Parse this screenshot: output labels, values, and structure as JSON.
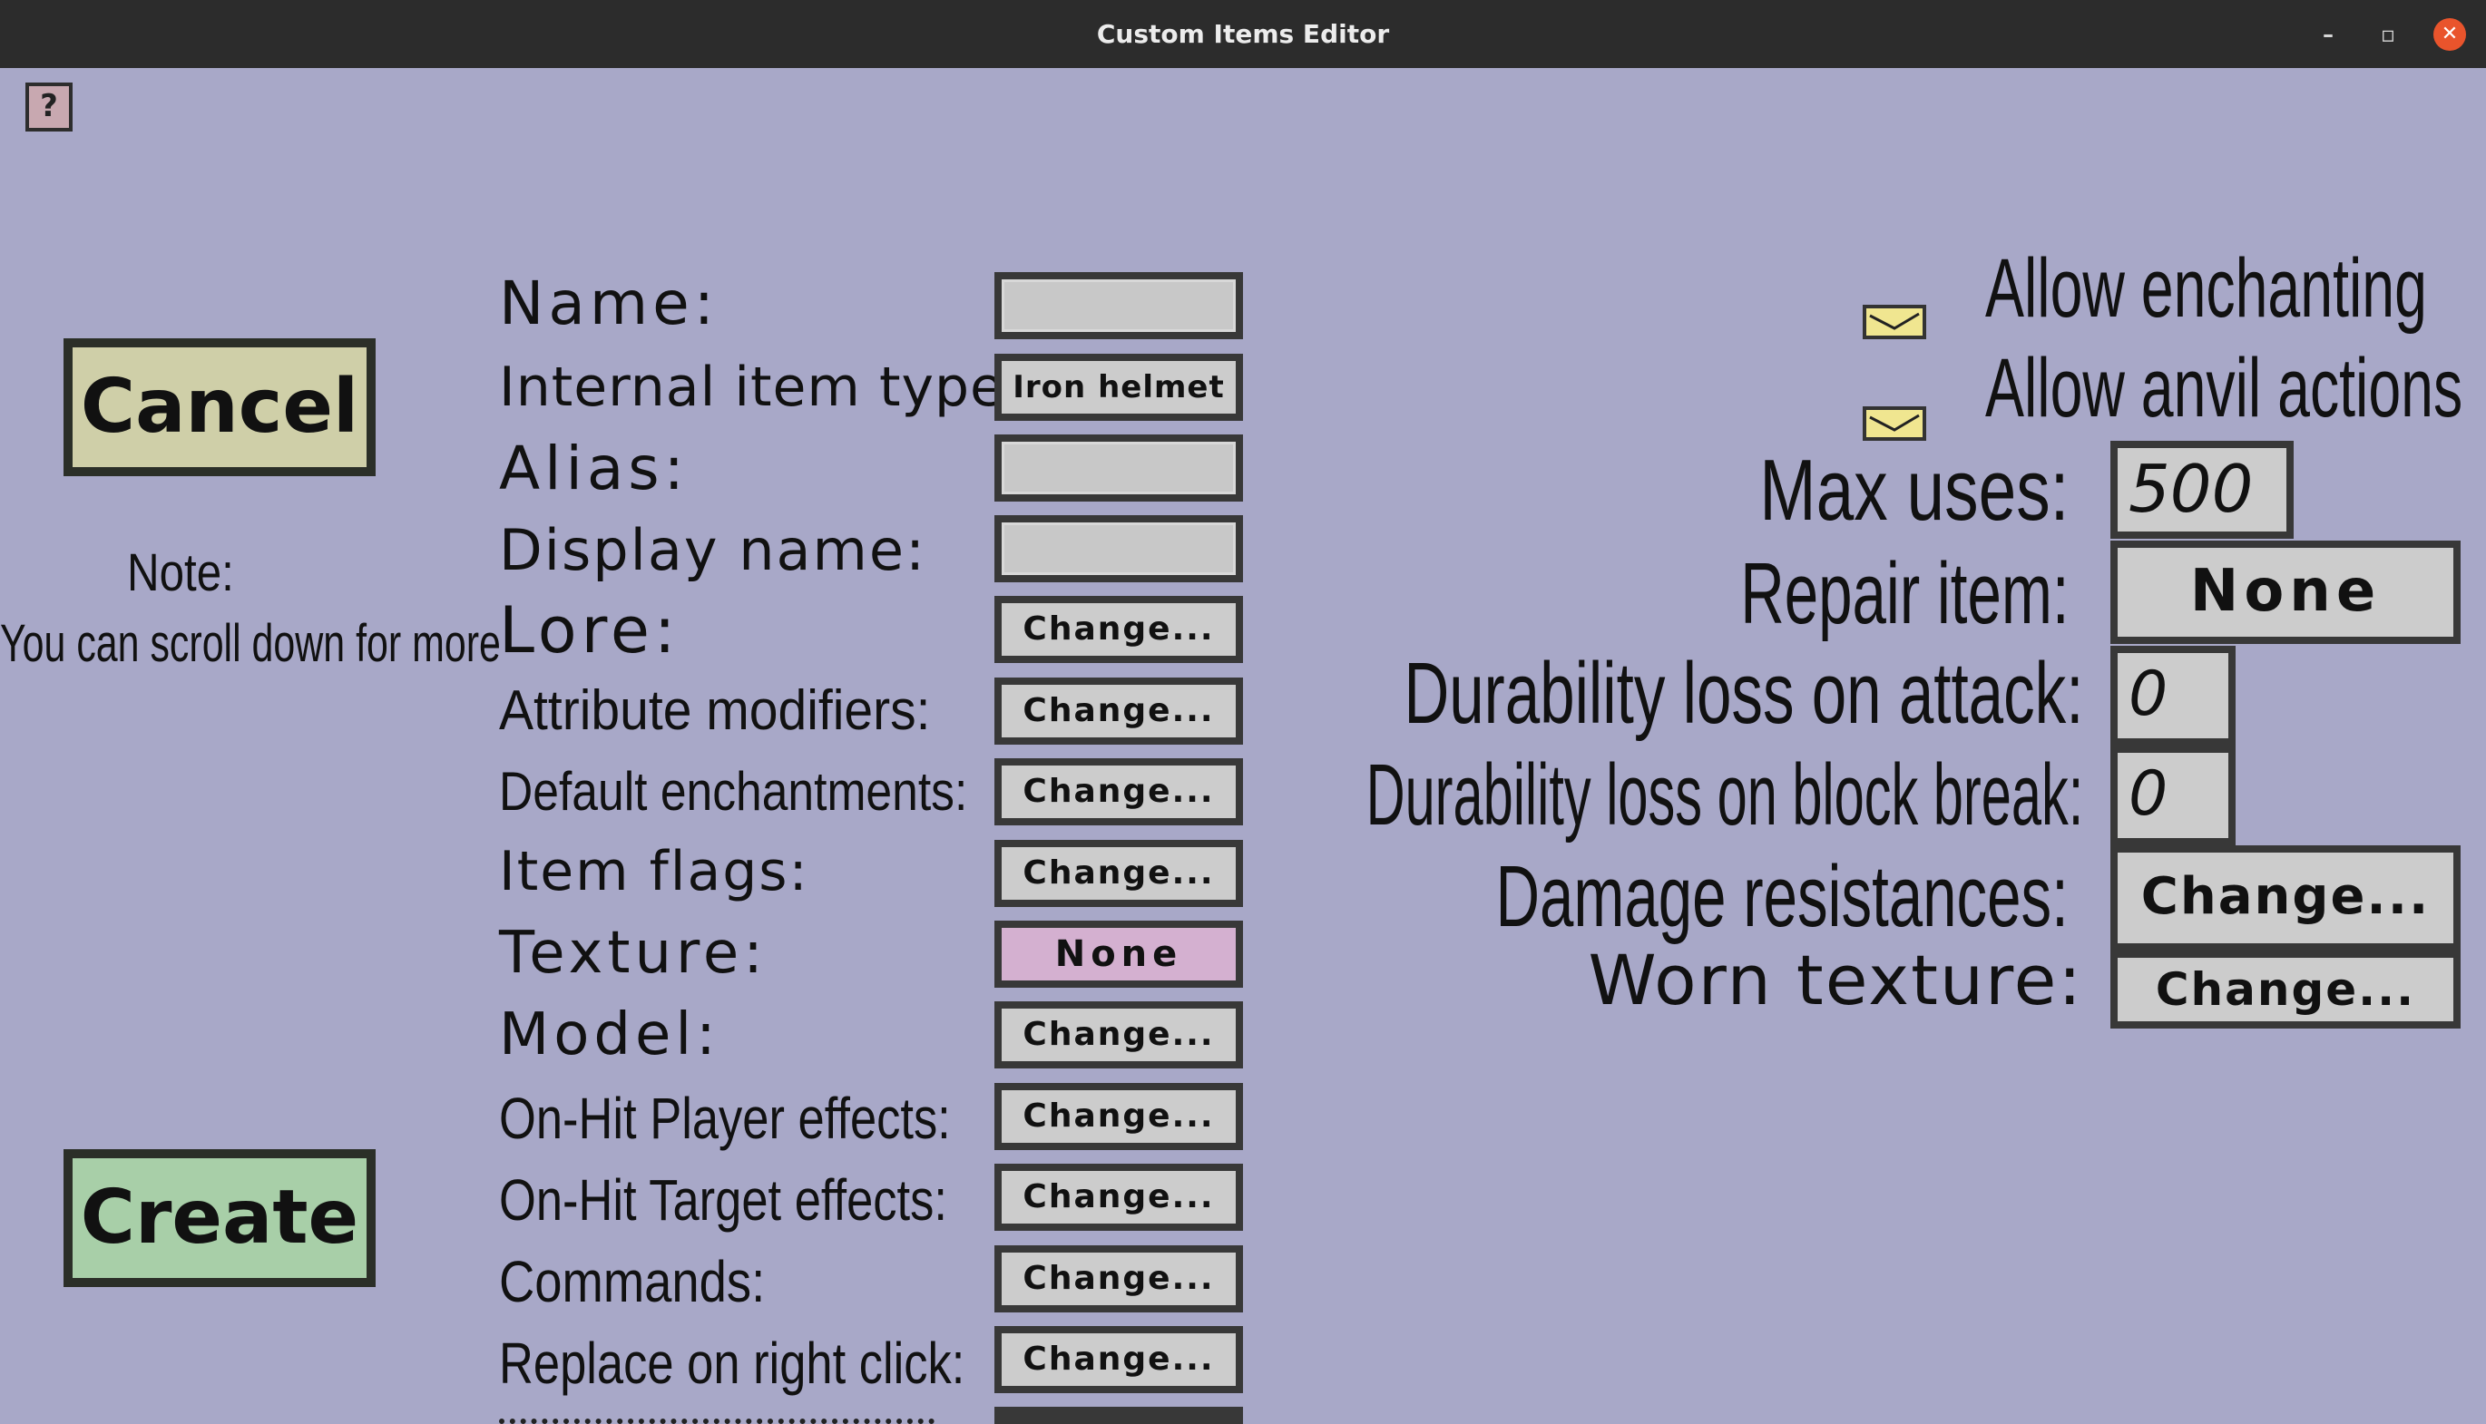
{
  "window": {
    "title": "Custom Items Editor",
    "minimize": "–",
    "maximize": "▫",
    "close": "✕"
  },
  "help_label": "?",
  "buttons": {
    "cancel": "Cancel",
    "create": "Create"
  },
  "note": {
    "title": "Note:",
    "text": "You can scroll down for more"
  },
  "form": {
    "name": {
      "label": "Name:",
      "value": ""
    },
    "internal_type": {
      "label": "Internal item type:",
      "value": "Iron helmet"
    },
    "alias": {
      "label": "Alias:",
      "value": ""
    },
    "display_name": {
      "label": "Display name:",
      "value": ""
    },
    "lore": {
      "label": "Lore:",
      "button": "Change..."
    },
    "attribute_modifiers": {
      "label": "Attribute modifiers:",
      "button": "Change..."
    },
    "default_enchantments": {
      "label": "Default enchantments:",
      "button": "Change..."
    },
    "item_flags": {
      "label": "Item flags:",
      "button": "Change..."
    },
    "texture": {
      "label": "Texture:",
      "button": "None"
    },
    "model": {
      "label": "Model:",
      "button": "Change..."
    },
    "on_hit_player": {
      "label": "On-Hit Player effects:",
      "button": "Change..."
    },
    "on_hit_target": {
      "label": "On-Hit Target effects:",
      "button": "Change..."
    },
    "commands": {
      "label": "Commands:",
      "button": "Change..."
    },
    "replace_right_click": {
      "label": "Replace on right click:",
      "button": "Change..."
    }
  },
  "right": {
    "allow_enchanting": {
      "label": "Allow enchanting",
      "checked": true
    },
    "allow_anvil": {
      "label": "Allow anvil actions",
      "checked": true
    },
    "max_uses": {
      "label": "Max uses:",
      "value": "500"
    },
    "repair_item": {
      "label": "Repair item:",
      "button": "None"
    },
    "durability_attack": {
      "label": "Durability loss on attack:",
      "value": "0"
    },
    "durability_block": {
      "label": "Durability loss on block break:",
      "value": "0"
    },
    "damage_resistances": {
      "label": "Damage resistances:",
      "button": "Change..."
    },
    "worn_texture": {
      "label": "Worn texture:",
      "button": "Change..."
    }
  },
  "colors": {
    "background": "#a8a8c8",
    "cancel": "#cfcfa8",
    "create": "#a8cfa8",
    "texture_button": "#d4b0d0",
    "checkbox": "#f0e690"
  }
}
